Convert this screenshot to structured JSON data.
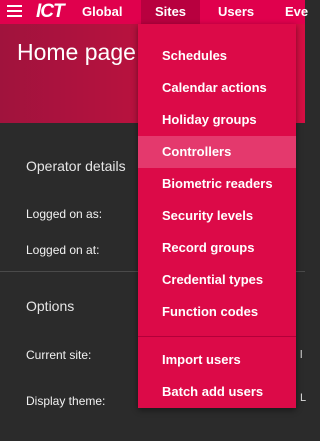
{
  "nav": {
    "logo": "ICT",
    "items": [
      {
        "label": "Global"
      },
      {
        "label": "Sites"
      },
      {
        "label": "Users"
      },
      {
        "label": "Eve"
      }
    ]
  },
  "header": {
    "title": "Home page"
  },
  "main": {
    "operator_section": {
      "title": "Operator details",
      "logged_on_as": "Logged on as:",
      "logged_on_at": "Logged on at:"
    },
    "options_section": {
      "title": "Options",
      "current_site": "Current site:",
      "display_theme": "Display theme:",
      "edge_marks": [
        "l",
        "L"
      ]
    }
  },
  "sites_menu": {
    "items": [
      {
        "label": "Schedules"
      },
      {
        "label": "Calendar actions"
      },
      {
        "label": "Holiday groups"
      },
      {
        "label": "Controllers",
        "active": true
      },
      {
        "label": "Biometric readers"
      },
      {
        "label": "Security levels"
      },
      {
        "label": "Record groups"
      },
      {
        "label": "Credential types"
      },
      {
        "label": "Function codes"
      },
      {
        "label": "Import users"
      },
      {
        "label": "Batch add users"
      }
    ]
  },
  "colors": {
    "brand": "#e0004d",
    "menu": "#dc0a48",
    "menu_active": "#e4396d",
    "background": "#2b2b2b"
  }
}
